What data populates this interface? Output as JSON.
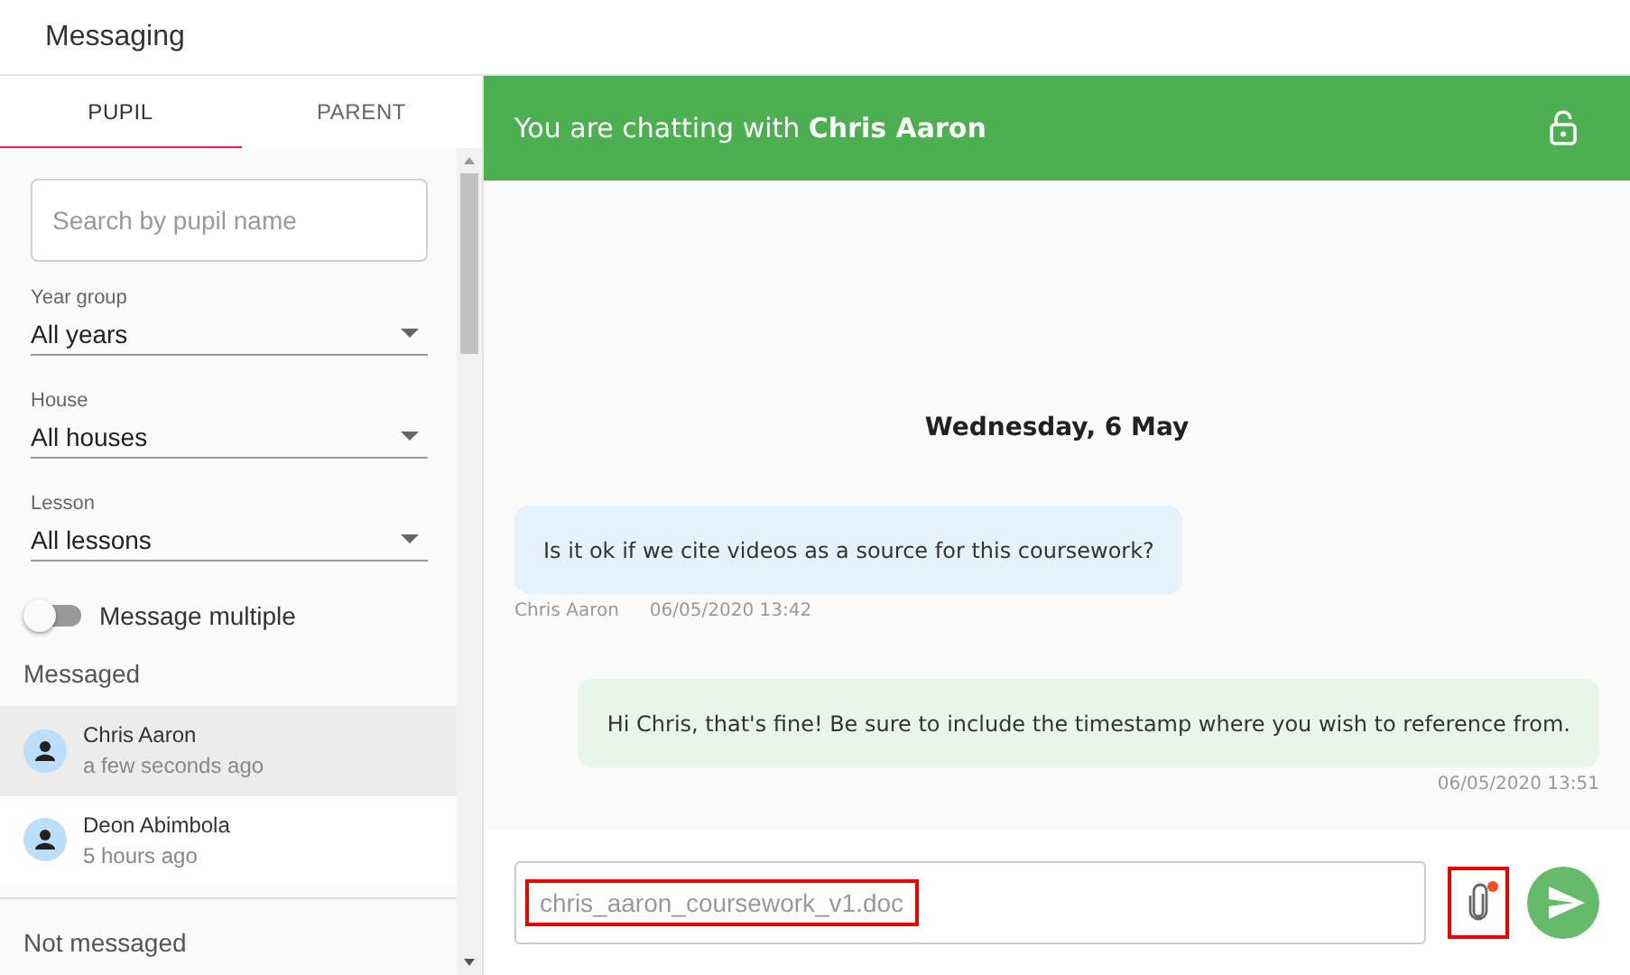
{
  "app_bar": {
    "title": "Messaging"
  },
  "tabs": [
    {
      "label": "PUPIL",
      "selected": true
    },
    {
      "label": "PARENT",
      "selected": false
    }
  ],
  "search": {
    "placeholder": "Search by pupil name"
  },
  "filters": [
    {
      "label": "Year group",
      "value": "All years"
    },
    {
      "label": "House",
      "value": "All houses"
    },
    {
      "label": "Lesson",
      "value": "All lessons"
    }
  ],
  "message_multiple": {
    "label": "Message multiple",
    "on": false
  },
  "messaged": {
    "heading": "Messaged",
    "contacts": [
      {
        "name": "Chris Aaron",
        "time": "a few seconds ago",
        "selected": true
      },
      {
        "name": "Deon Abimbola",
        "time": "5 hours ago",
        "selected": false
      }
    ]
  },
  "not_messaged": {
    "heading": "Not messaged"
  },
  "chat": {
    "header": "You are chatting with **Chris Aaron**",
    "date": "Wednesday, 6 May",
    "messages": [
      {
        "kind": "received",
        "text": "Is it ok if we cite videos as a source for this coursework?",
        "sender": "Chris Aaron",
        "time": "06/05/2020 13:42"
      },
      {
        "kind": "sent",
        "text": "Hi Chris, that's fine! Be sure to include the timestamp where you wish to reference from.",
        "time": "06/05/2020 13:51"
      }
    ]
  },
  "composer": {
    "value": "chris_aaron_coursework_v1.doc",
    "value_highlighted": true,
    "attach_highlighted": true,
    "attachment_pending": true
  }
}
